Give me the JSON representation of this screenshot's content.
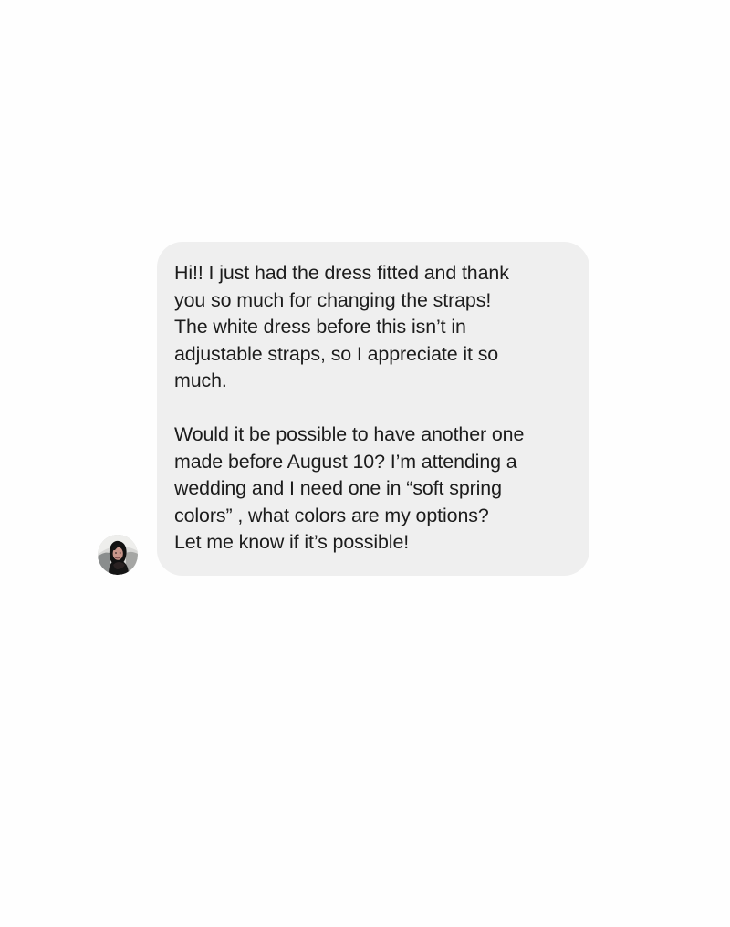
{
  "conversation": {
    "sender": {
      "avatar_icon": "profile-photo"
    },
    "message": {
      "paragraphs": [
        {
          "lines": [
            "Hi!! I just had the dress fitted and thank",
            "you so much for changing the straps!",
            "The white dress before this isn’t in",
            "adjustable straps, so I appreciate it so",
            "much."
          ]
        },
        {
          "lines": [
            "Would it be possible to have another one",
            "made before August 10? I’m attending a",
            "wedding and I need one in “soft spring",
            "colors” , what colors are my options?",
            "Let me know if it’s possible!"
          ]
        }
      ]
    }
  },
  "colors": {
    "background": "#fefefe",
    "bubble": "#efefef",
    "text": "#1c1c1c"
  }
}
